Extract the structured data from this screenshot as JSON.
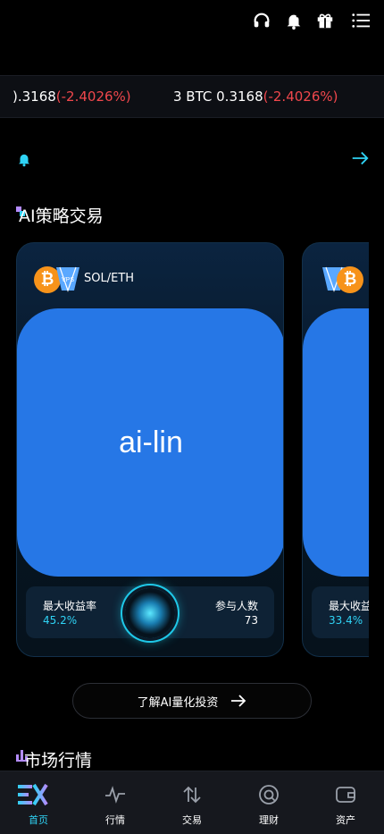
{
  "header": {
    "icons": [
      "headset-icon",
      "bell-icon",
      "gift-icon",
      "menu-icon"
    ]
  },
  "ticker": {
    "items": [
      {
        "text": ").3168",
        "change": "(-2.4026%)"
      },
      {
        "text": "3 BTC 0.3168",
        "change": "(-2.4026%)"
      }
    ]
  },
  "notice": {
    "icon": "bell-icon",
    "arrow": "arrow-right-icon"
  },
  "strategy_section": {
    "title": "AI策略交易",
    "cards": [
      {
        "pair": "SOL/ETH",
        "image_alt": "ai-lin",
        "max_yield_label": "最大收益率",
        "max_yield_value": "45.2%",
        "participants_label": "参与人数",
        "participants_value": "73"
      },
      {
        "max_yield_label": "最大收益",
        "max_yield_value": "33.4%"
      }
    ],
    "learn_button": "了解AI量化投资"
  },
  "market_section": {
    "title": "市场行情"
  },
  "tabbar": {
    "items": [
      {
        "label": "首页",
        "active": true
      },
      {
        "label": "行情"
      },
      {
        "label": "交易"
      },
      {
        "label": "理财"
      },
      {
        "label": "资产"
      }
    ]
  },
  "colors": {
    "accent": "#2fd3f5",
    "negative": "#f0474c",
    "image_bg": "#2677e6"
  }
}
